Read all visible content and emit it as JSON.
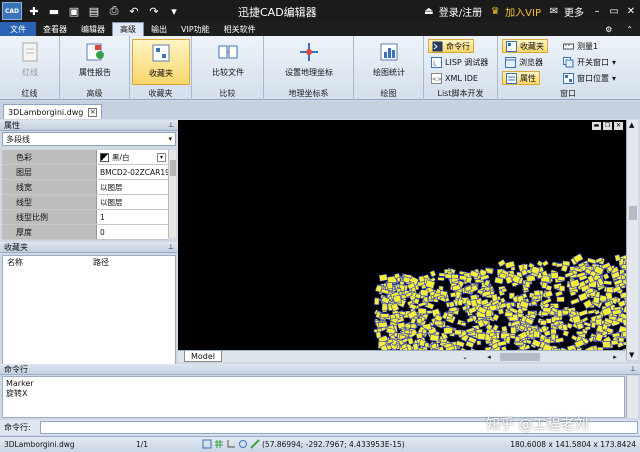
{
  "title": "迅捷CAD编辑器",
  "app_logo": "CAD",
  "titlebar_right": {
    "login": "登录/注册",
    "vip": "加入VIP",
    "more": "更多"
  },
  "menu_tabs": [
    "文件",
    "查看器",
    "编辑器",
    "高级",
    "输出",
    "VIP功能",
    "相关软件"
  ],
  "ribbon": {
    "line_button": "红线",
    "line_group": "红线",
    "attr_report": "属性报告",
    "advanced_group": "高级",
    "favorites": "收藏夹",
    "favorites_group": "收藏夹",
    "compare": "比较文件",
    "compare_group": "比较",
    "geo_setup": "设置地理坐标",
    "geo_group": "地理坐标系",
    "stats": "绘图统计",
    "draw_group": "绘图",
    "cmdline": "命令行",
    "lisp": "LISP 调试器",
    "xml": "XML IDE",
    "list_group": "List脚本开发",
    "fav_small": "收藏夹",
    "browser": "浏览器",
    "props": "属性",
    "measure": "测量1",
    "switch_window": "开关窗口",
    "window_pos": "窗口位置",
    "window_group": "窗口"
  },
  "doc_tab": "3DLamborgini.dwg",
  "properties": {
    "header": "属性",
    "selector": "多段线",
    "rows": [
      {
        "k": "色彩",
        "v": "黑/白"
      },
      {
        "k": "图层",
        "v": "BMCD2-02ZCAR19"
      },
      {
        "k": "线宽",
        "v": "以图层"
      },
      {
        "k": "线型",
        "v": "以图层"
      },
      {
        "k": "线型比例",
        "v": "1"
      },
      {
        "k": "厚度",
        "v": "0"
      }
    ]
  },
  "favorites_panel": {
    "header": "收藏夹",
    "col_name": "名称",
    "col_path": "路径"
  },
  "model_tab": "Model",
  "command": {
    "header": "命令行",
    "lines": [
      "Marker",
      "旋转X"
    ],
    "input_label": "命令行:"
  },
  "status": {
    "file": "3DLamborgini.dwg",
    "page": "1/1",
    "coords": "(57.86994; -292.7967; 4.433953E-15)",
    "size": "180.6008 x 141.5804 x 173.8424"
  },
  "watermark": "知乎 @工程老刘",
  "colors": {
    "accent": "#2a63b5",
    "vip": "#f3c12b",
    "selected": "#f7d56a",
    "drawing": "#f2ee3a",
    "drawing_edge": "#2c35c8"
  }
}
